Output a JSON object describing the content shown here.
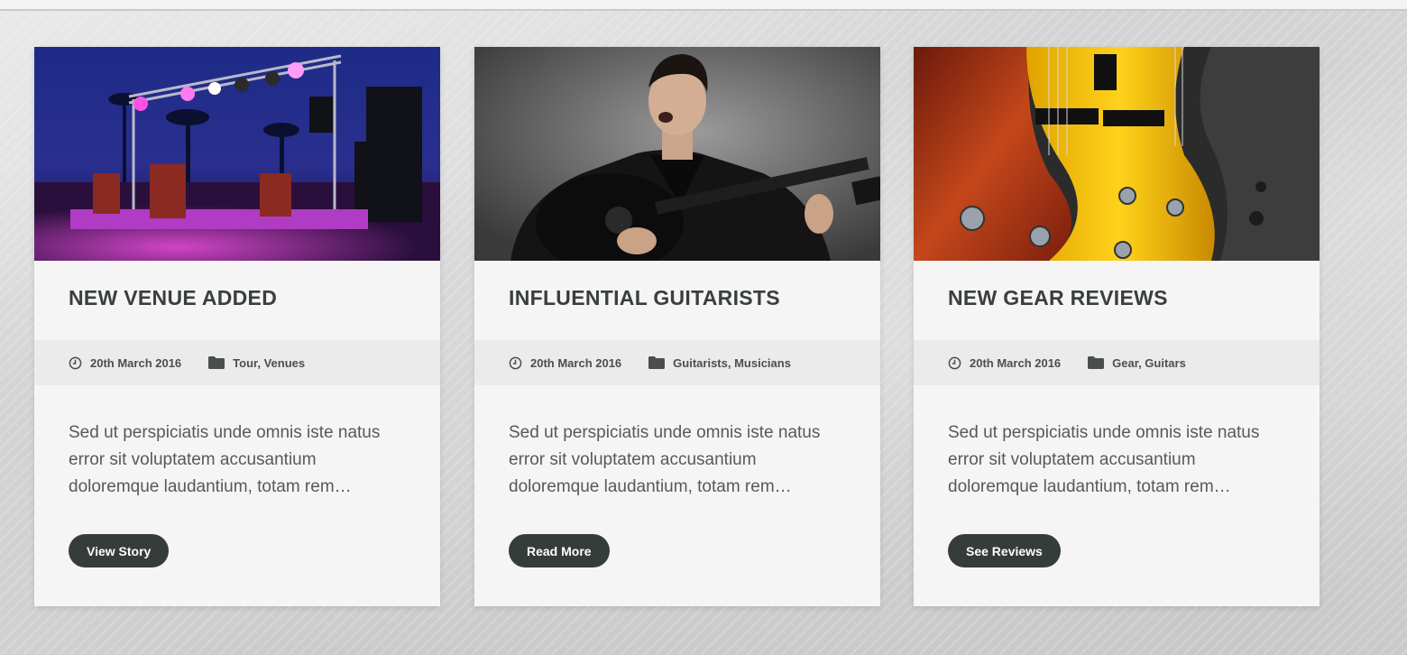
{
  "posts": [
    {
      "title": "NEW VENUE ADDED",
      "date": "20th March 2016",
      "categories": "Tour, Venues",
      "excerpt": "Sed ut perspiciatis unde omnis iste natus error sit voluptatem accusantium doloremque laudantium, totam rem…",
      "button_label": "View Story",
      "image": "outdoor-stage-photo"
    },
    {
      "title": "INFLUENTIAL GUITARISTS",
      "date": "20th March 2016",
      "categories": "Guitarists, Musicians",
      "excerpt": "Sed ut perspiciatis unde omnis iste natus error sit voluptatem accusantium doloremque laudantium, totam rem…",
      "button_label": "Read More",
      "image": "guitarist-singing-photo"
    },
    {
      "title": "NEW GEAR REVIEWS",
      "date": "20th March 2016",
      "categories": "Gear, Guitars",
      "excerpt": "Sed ut perspiciatis unde omnis iste natus error sit voluptatem accusantium doloremque laudantium, totam rem…",
      "button_label": "See Reviews",
      "image": "electric-guitars-photo"
    }
  ],
  "icons": {
    "date": "clock-icon",
    "categories": "folder-icon"
  },
  "colors": {
    "button_bg": "#353c39",
    "meta_bar": "#ebebeb",
    "card_bg": "#f5f5f5",
    "title": "#3a3f3e"
  }
}
